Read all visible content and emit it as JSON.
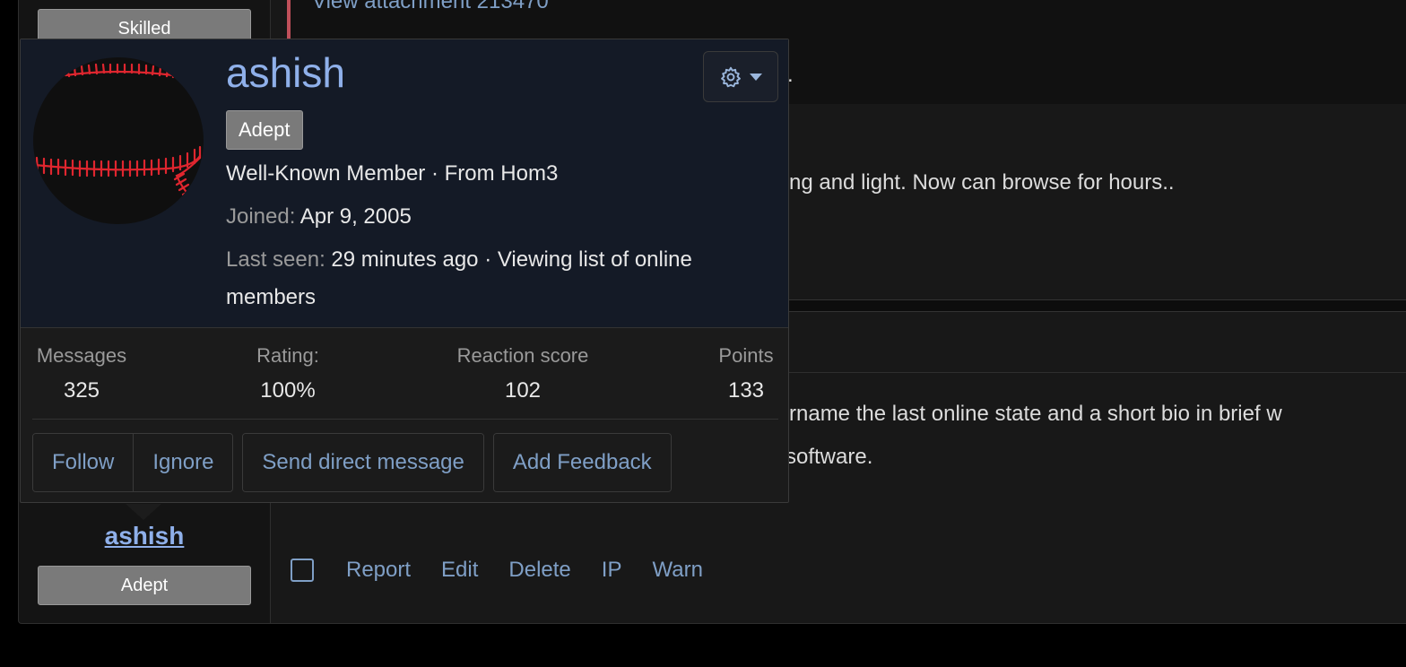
{
  "background": {
    "top_badge": "Skilled",
    "attachment_link": "View attachment 213470",
    "quote_tail": ".",
    "post1_text": "ng and light. Now can browse for hours..",
    "post2_line1": "rname the last online state and a short bio in brief w",
    "post2_line2": "software.",
    "author": {
      "username": "ashish",
      "rank": "Adept"
    },
    "actions": [
      "Report",
      "Edit",
      "Delete",
      "IP",
      "Warn"
    ]
  },
  "card": {
    "username": "ashish",
    "badge": "Adept",
    "title_line": "Well-Known Member · From Hom3",
    "joined_label": "Joined:",
    "joined_value": "Apr 9, 2005",
    "last_seen_label": "Last seen:",
    "last_seen_value": "29 minutes ago · Viewing list of online",
    "last_seen_value_2": "members",
    "settings_icon": "gear-icon",
    "stats": [
      {
        "label": "Messages",
        "value": "325"
      },
      {
        "label": "Rating:",
        "value": "100%"
      },
      {
        "label": "Reaction score",
        "value": "102"
      },
      {
        "label": "Points",
        "value": "133"
      }
    ],
    "buttons": {
      "follow": "Follow",
      "ignore": "Ignore",
      "send_dm": "Send direct message",
      "feedback": "Add Feedback"
    }
  },
  "colors": {
    "link": "#7f9fc6",
    "username": "#8fb0ea",
    "quote_bar": "#c0505a",
    "avatar_stitch": "#e0262f"
  }
}
